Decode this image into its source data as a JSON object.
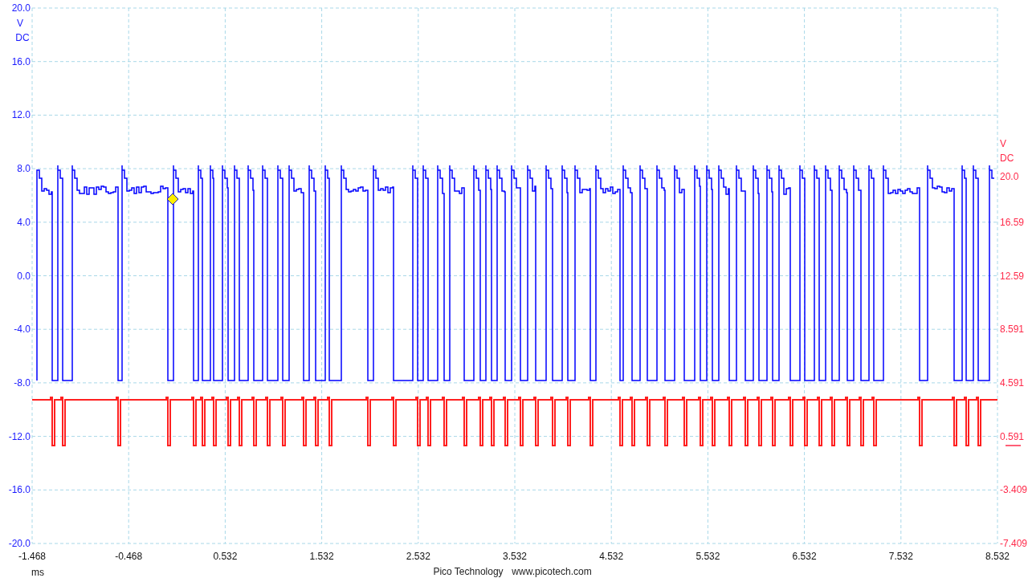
{
  "left_axis": {
    "unit": "V",
    "coupling": "DC",
    "color": "#1a1aff",
    "ticks": [
      "20.0",
      "16.0",
      "12.0",
      "8.0",
      "4.0",
      "0.0",
      "-4.0",
      "-8.0",
      "-12.0",
      "-16.0",
      "-20.0"
    ]
  },
  "right_axis": {
    "unit": "V",
    "coupling": "DC",
    "color": "#ff2a4a",
    "ticks": [
      "20.0",
      "16.59",
      "12.59",
      "8.591",
      "4.591",
      "0.591",
      "-3.409",
      "-7.409"
    ]
  },
  "x_axis": {
    "unit": "ms",
    "ticks": [
      "-1.468",
      "-0.468",
      "0.532",
      "1.532",
      "2.532",
      "3.532",
      "4.532",
      "5.532",
      "6.532",
      "7.532",
      "8.532"
    ]
  },
  "traces": [
    {
      "color": "#0000ff"
    },
    {
      "color": "#ff2020"
    }
  ],
  "footer": {
    "company": "Pico Technology",
    "website": "www.picotech.com"
  }
}
